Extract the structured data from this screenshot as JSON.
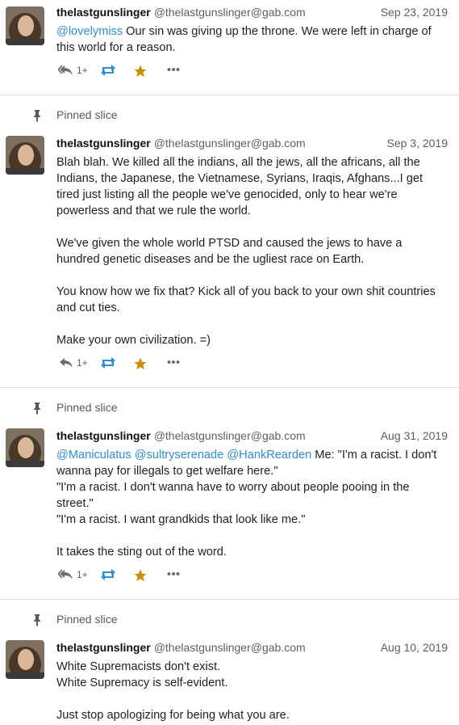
{
  "posts": [
    {
      "pinned": false,
      "name": "thelastgunslinger",
      "handle": "@thelastgunslinger@gab.com",
      "date": "Sep 23, 2019",
      "lines": [
        {
          "mention": "@lovelymiss",
          "text": " Our sin was giving up the throne. We were left in charge of this world for a reason."
        }
      ],
      "reply_count": "1+"
    },
    {
      "pinned": true,
      "pinned_label": "Pinned slice",
      "name": "thelastgunslinger",
      "handle": "@thelastgunslinger@gab.com",
      "date": "Sep 3, 2019",
      "paragraphs": [
        "Blah blah. We killed all the indians, all the jews, all the africans, all the Indians, the Japanese, the Vietnamese, Syrians, Iraqis, Afghans...I get tired just listing all the people we've genocided, only to hear we're powerless and that we rule the world.",
        "We've given the whole world PTSD and caused the jews to have a hundred genetic diseases and be the ugliest race on Earth.",
        "You know how we fix that? Kick all of you back to your own shit countries and cut ties.",
        "Make your own civilization. =)"
      ],
      "reply_count": "1+"
    },
    {
      "pinned": true,
      "pinned_label": "Pinned slice",
      "name": "thelastgunslinger",
      "handle": "@thelastgunslinger@gab.com",
      "date": "Aug 31, 2019",
      "mentions": [
        "@Maniculatus",
        "@sultryserenade",
        "@HankRearden"
      ],
      "first_text": " Me: \"I'm a racist. I don't wanna pay for illegals to get welfare here.\"",
      "lines": [
        "\"I'm a racist. I don't wanna have to worry about people pooing in the street.\"",
        "\"I'm a racist. I want grandkids that look like me.\""
      ],
      "last_paragraph": "It takes the sting out of the word.",
      "reply_count": "1+"
    },
    {
      "pinned": true,
      "pinned_label": "Pinned slice",
      "name": "thelastgunslinger",
      "handle": "@thelastgunslinger@gab.com",
      "date": "Aug 10, 2019",
      "lines": [
        "White Supremacists don't exist.",
        "White Supremacy is self-evident."
      ],
      "last_paragraph": "Just stop apologizing for being what you are."
    }
  ],
  "icons": {
    "reply": "reply-all-icon",
    "boost": "retweet-icon",
    "favourite": "star-icon",
    "more": "ellipsis-icon",
    "pin": "pin-icon"
  },
  "colors": {
    "mention": "#2b90d9",
    "star": "#ca8f04",
    "boost": "#2b90d9",
    "muted": "#5c5f63"
  }
}
